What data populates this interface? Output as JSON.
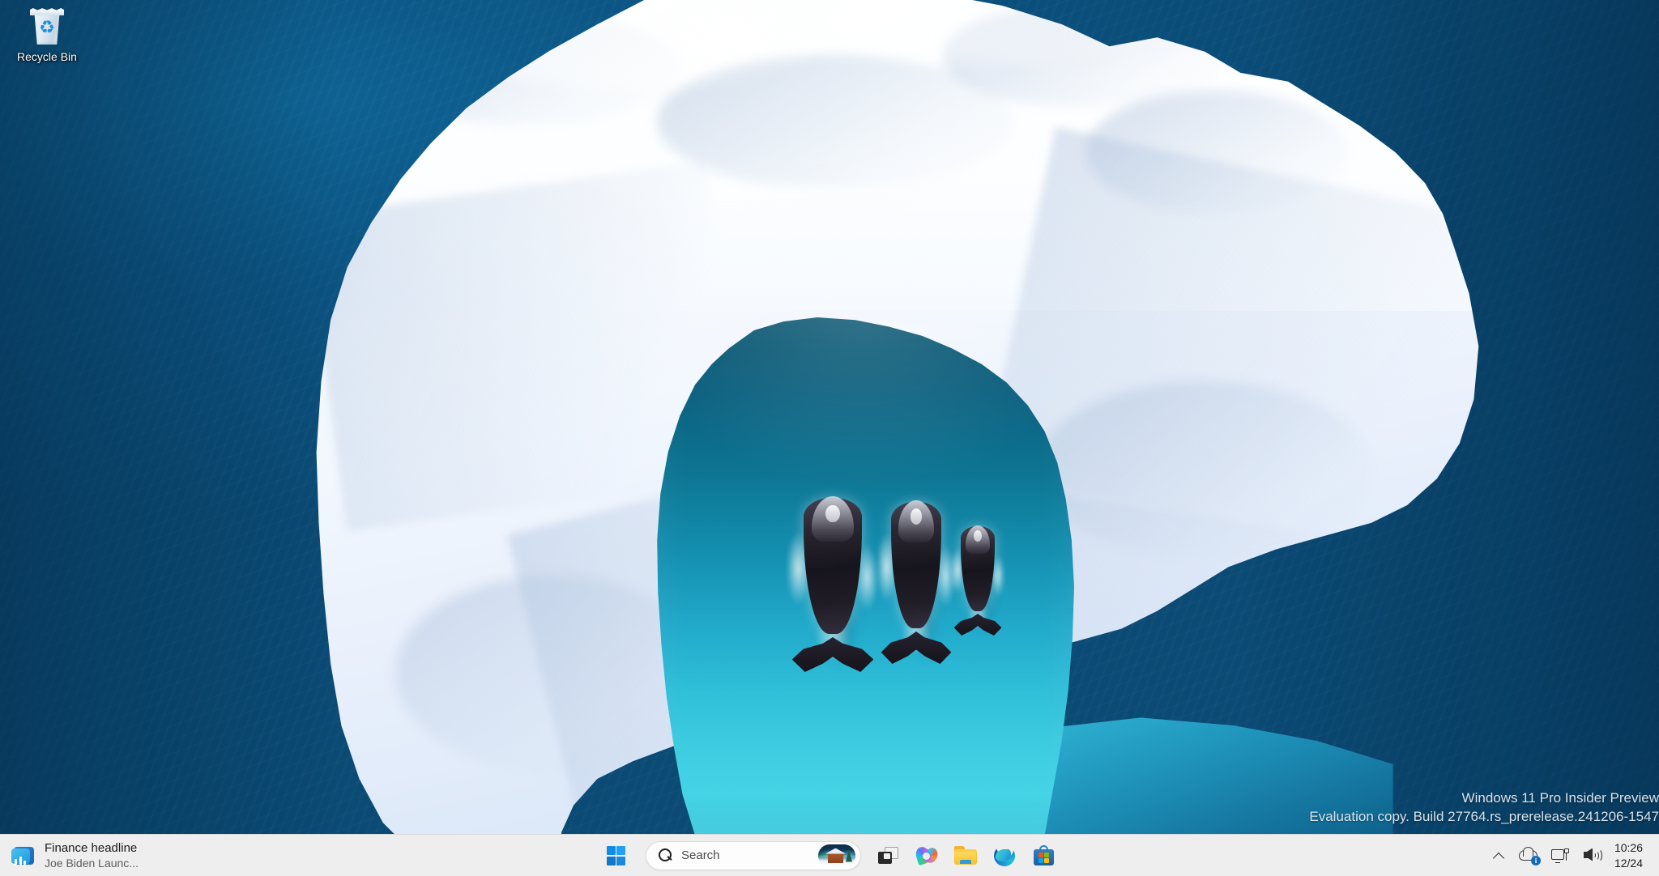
{
  "desktop": {
    "icons": [
      {
        "name": "recycle-bin",
        "label": "Recycle Bin"
      }
    ],
    "wallpaper_description": "Aerial photo of an arch-shaped iceberg with a turquoise lagoon and three bowhead whales swimming"
  },
  "watermark": {
    "line1": "Windows 11 Pro Insider Preview",
    "line2": "Evaluation copy. Build 27764.rs_prerelease.241206-1547"
  },
  "taskbar": {
    "widgets": {
      "title": "Finance headline",
      "subtitle": "Joe Biden Launc...",
      "icon": "news-finance-icon"
    },
    "start": {
      "label": "Start",
      "icon": "windows-logo-icon"
    },
    "search": {
      "placeholder": "Search",
      "value": "",
      "icon": "search-icon",
      "thumbnail": "winter-cabin-aurora-thumbnail"
    },
    "apps": [
      {
        "name": "task-view",
        "label": "Task View",
        "icon": "task-view-icon"
      },
      {
        "name": "copilot",
        "label": "Copilot",
        "icon": "copilot-icon"
      },
      {
        "name": "file-explorer",
        "label": "File Explorer",
        "icon": "folder-icon"
      },
      {
        "name": "microsoft-edge",
        "label": "Microsoft Edge",
        "icon": "edge-icon"
      },
      {
        "name": "microsoft-store",
        "label": "Microsoft Store",
        "icon": "store-bag-icon"
      }
    ],
    "tray": {
      "overflow": {
        "label": "Show hidden icons",
        "icon": "chevron-up-icon"
      },
      "onedrive": {
        "label": "OneDrive",
        "icon": "cloud-icon",
        "badge": "i"
      },
      "network": {
        "label": "Network",
        "icon": "monitor-network-icon"
      },
      "volume": {
        "label": "Volume",
        "icon": "speaker-icon"
      }
    },
    "clock": {
      "time": "10:26",
      "date": "12/24"
    }
  },
  "colors": {
    "ocean": "#0c5685",
    "lagoon_top": "#0a5570",
    "lagoon_bottom": "#45d3e6",
    "ice": "#f4f9ff",
    "taskbar": "#eeeeee",
    "accent": "#0f6cbd"
  }
}
